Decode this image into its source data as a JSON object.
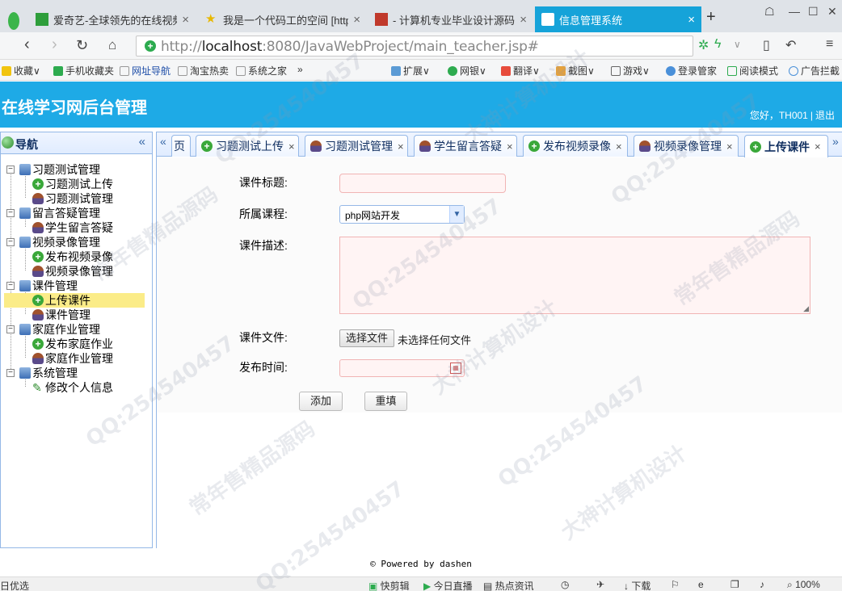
{
  "browser": {
    "tabs": [
      {
        "title": "爱奇艺-全球领先的在线视频"
      },
      {
        "title": "我是一个代码工的空间 [http"
      },
      {
        "title": "- 计算机专业毕业设计源码"
      },
      {
        "title": "信息管理系统"
      }
    ],
    "url_host": "localhost",
    "url_rest": ":8080/JavaWebProject/main_teacher.jsp#",
    "url_prefix": "http://",
    "bookmarks": [
      "收藏",
      "手机收藏夹",
      "网址导航",
      "淘宝热卖",
      "系统之家",
      "»",
      "扩展",
      "网银",
      "翻译",
      "截图",
      "游戏",
      "登录管家",
      "阅读模式",
      "广告拦截"
    ]
  },
  "app": {
    "title": "在线学习网后台管理",
    "greeting": "您好，TH001",
    "logout": "退出"
  },
  "nav": {
    "title": "导航",
    "collapse": "«",
    "groups": [
      {
        "label": "习题测试管理",
        "items": [
          "习题测试上传",
          "习题测试管理"
        ]
      },
      {
        "label": "留言答疑管理",
        "items": [
          "学生留言答疑"
        ]
      },
      {
        "label": "视频录像管理",
        "items": [
          "发布视频录像",
          "视频录像管理"
        ]
      },
      {
        "label": "课件管理",
        "items": [
          "上传课件",
          "课件管理"
        ]
      },
      {
        "label": "家庭作业管理",
        "items": [
          "发布家庭作业",
          "家庭作业管理"
        ]
      },
      {
        "label": "系统管理",
        "items": [
          "修改个人信息"
        ]
      }
    ],
    "selected": "上传课件"
  },
  "tabs": {
    "scroll_left": "«",
    "scroll_right": "»",
    "first_partial": "页",
    "items": [
      "习题测试上传",
      "习题测试管理",
      "学生留言答疑",
      "发布视频录像",
      "视频录像管理",
      "上传课件"
    ],
    "active": "上传课件",
    "close": "×"
  },
  "form": {
    "title_label": "课件标题:",
    "course_label": "所属课程:",
    "course_value": "php网站开发",
    "desc_label": "课件描述:",
    "file_label": "课件文件:",
    "file_button": "选择文件",
    "file_status": "未选择任何文件",
    "time_label": "发布时间:",
    "add_button": "添加",
    "reset_button": "重填"
  },
  "footer": "© Powered by dashen",
  "statusbar": [
    "日优选",
    "快剪辑",
    "今日直播",
    "热点资讯",
    "下载",
    "100%"
  ],
  "watermark": [
    "QQ:254540457",
    "大神计算机设计",
    "常年售精品源码"
  ]
}
